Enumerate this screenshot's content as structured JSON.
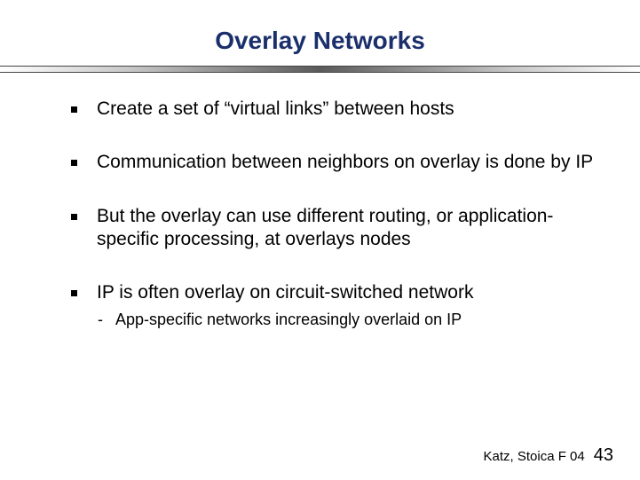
{
  "title": "Overlay Networks",
  "bullets": [
    "Create a set of “virtual links” between hosts",
    "Communication between neighbors on overlay is done by IP",
    "But the overlay can use different routing, or application-specific processing, at overlays nodes",
    "IP is often overlay on circuit-switched network"
  ],
  "subbullets": {
    "b3": [
      "App-specific networks increasingly overlaid on IP"
    ]
  },
  "footer": {
    "attribution": "Katz, Stoica F 04",
    "page": "43"
  }
}
